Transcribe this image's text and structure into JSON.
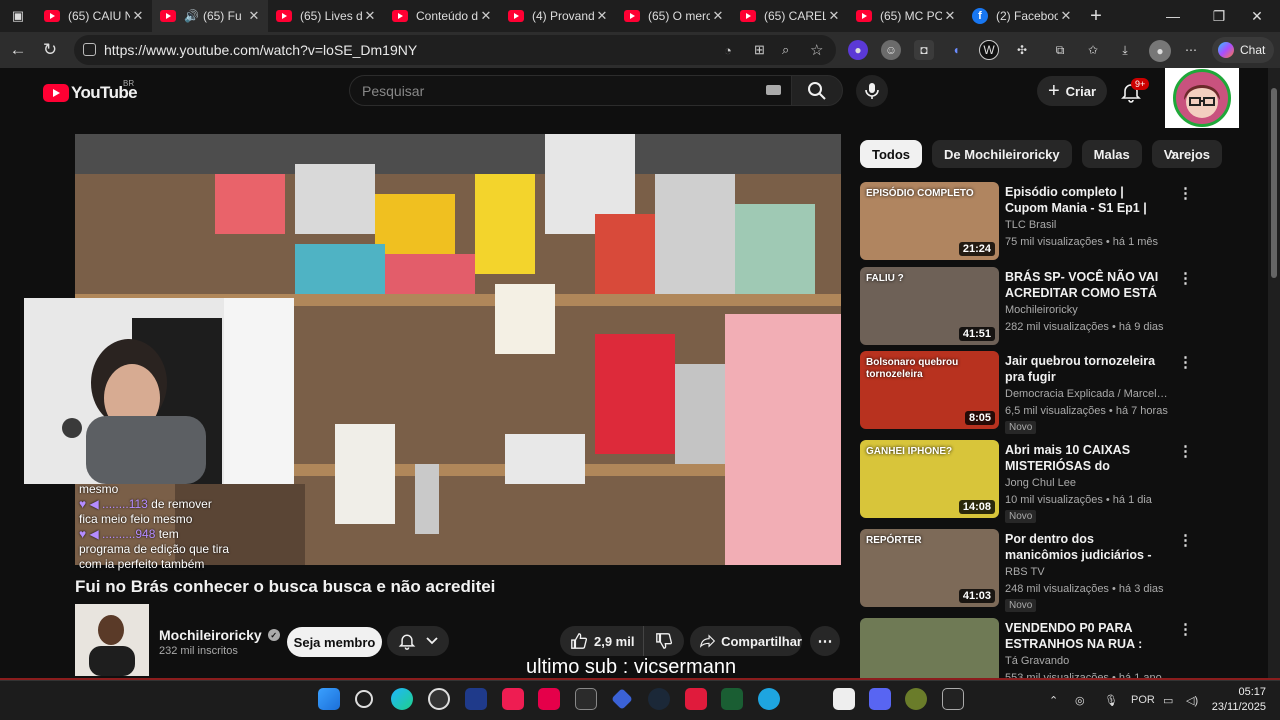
{
  "browser": {
    "tabs": [
      {
        "title": "(65) CAIU NI",
        "type": "yt"
      },
      {
        "title": "(65) Fu",
        "type": "yt",
        "active": true,
        "audio": true
      },
      {
        "title": "(65) Lives de",
        "type": "yt"
      },
      {
        "title": "Conteúdo d",
        "type": "yt"
      },
      {
        "title": "(4) Provand",
        "type": "yt"
      },
      {
        "title": "(65) O merc",
        "type": "yt"
      },
      {
        "title": "(65) CAREL",
        "type": "yt"
      },
      {
        "title": "(65) MC PO",
        "type": "yt"
      },
      {
        "title": "(2) Faceboo",
        "type": "fb"
      }
    ],
    "url": "https://www.youtube.com/watch?v=loSE_Dm19NY",
    "chat_label": "Chat"
  },
  "youtube": {
    "logo_text": "YouTube",
    "country_code": "BR",
    "search_placeholder": "Pesquisar",
    "create_label": "Criar",
    "notif_badge": "9+",
    "chips": [
      "Todos",
      "De Mochileiroricky",
      "Malas",
      "Varejos"
    ],
    "video": {
      "title": "Fui no Brás conhecer o busca busca e não acreditei",
      "channel": "Mochileiroricky",
      "subscribers": "232 mil inscritos",
      "member_label": "Seja membro",
      "likes": "2,9 mil",
      "share_label": "Compartilhar",
      "overlay_lines": [
        {
          "user": "",
          "text": "mesmo"
        },
        {
          "user": "♥ ◀ ........113",
          "text": " de remover"
        },
        {
          "user": "",
          "text": "fica meio feio mesmo"
        },
        {
          "user": "♥ ◀ ..........948",
          "text": " tem"
        },
        {
          "user": "",
          "text": "programa de edição que tira"
        },
        {
          "user": "",
          "text": "com ia perfeito também"
        }
      ],
      "last_sub": "ultimo sub : vicsermann"
    },
    "recommendations": [
      {
        "title": "Episódio completo | Cupom Mania - S1 Ep1 | TLC Brasil",
        "channel": "TLC Brasil",
        "meta": "75 mil visualizações • há 1 mês",
        "duration": "21:24",
        "new": false,
        "thumb_color": "#b08560",
        "thumb_text": "EPISÓDIO COMPLETO"
      },
      {
        "title": "BRÁS SP- VOCÊ NÃO VAI ACREDITAR COMO ESTÁ EM ...",
        "channel": "Mochileiroricky",
        "meta": "282 mil visualizações • há 9 dias",
        "duration": "41:51",
        "new": false,
        "thumb_color": "#6e6157",
        "thumb_text": "FALIU ?"
      },
      {
        "title": "Jair quebrou tornozeleira pra fugir",
        "channel": "Democracia Explicada / Marcelo Marcen...",
        "meta": "6,5 mil visualizações • há 7 horas",
        "duration": "8:05",
        "new": true,
        "thumb_color": "#b8321f",
        "thumb_text": "Bolsonaro quebrou tornozeleira"
      },
      {
        "title": "Abri mais 10 CAIXAS MISTERIÓSAS do Shopping",
        "channel": "Jong Chul Lee",
        "meta": "10 mil visualizações • há 1 dia",
        "duration": "14:08",
        "new": true,
        "thumb_color": "#d8c53a",
        "thumb_text": "GANHEI IPHONE?"
      },
      {
        "title": "Por dentro dos manicômios judiciários - Profissão Repórter",
        "channel": "RBS TV",
        "meta": "248 mil visualizações • há 3 dias",
        "duration": "41:03",
        "new": true,
        "thumb_color": "#7d6a58",
        "thumb_text": "REPÓRTER"
      },
      {
        "title": "VENDENDO P0 PARA ESTRANHOS NA RUA : MAND...",
        "channel": "Tá Gravando",
        "meta": "553 mil visualizações • há 1 ano",
        "duration": "",
        "new": false,
        "thumb_color": "#6f7a55",
        "thumb_text": ""
      }
    ],
    "new_label": "Novo"
  },
  "taskbar": {
    "lang": "POR",
    "time": "05:17",
    "date": "23/11/2025"
  }
}
